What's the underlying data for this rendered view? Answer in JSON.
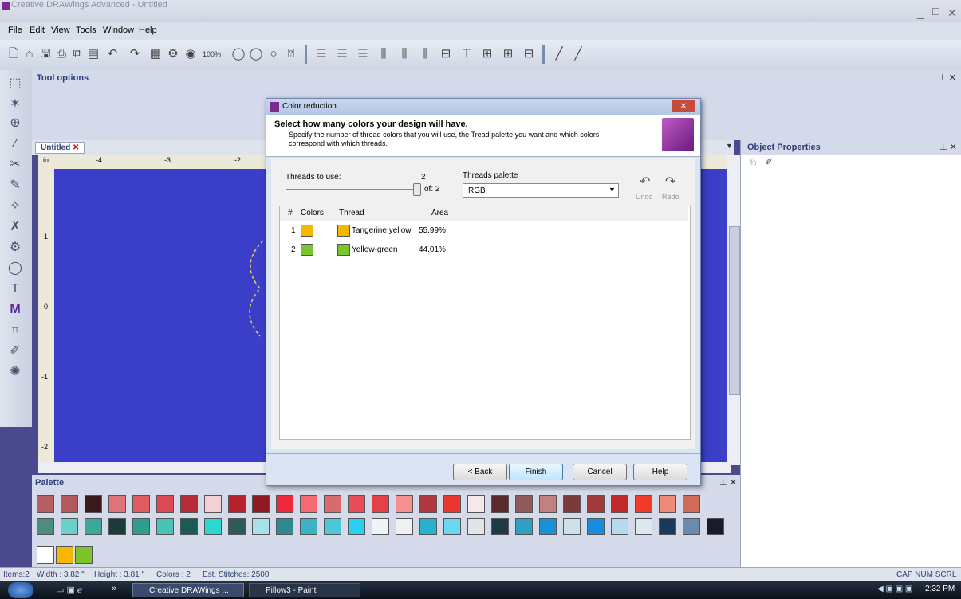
{
  "window": {
    "title": "Creative DRAWings Advanced - Untitled",
    "controls": [
      "_",
      "☐",
      "✕"
    ]
  },
  "menu": [
    "File",
    "Edit",
    "View",
    "Tools",
    "Window",
    "Help"
  ],
  "toolbar": {
    "zoom": "100%"
  },
  "panels": {
    "tool_options": "Tool options",
    "object_properties": "Object Properties",
    "palette": "Palette"
  },
  "document": {
    "tab": "Untitled",
    "ruler_unit": "in",
    "ruler_top": [
      "-4",
      "-3",
      "-2"
    ],
    "ruler_left": [
      "-1",
      "-0",
      "-1",
      "-2"
    ]
  },
  "dialog": {
    "title": "Color reduction",
    "heading": "Select how many colors your design will have.",
    "description": "Specify the number of thread colors that you will use, the Tread palette you want and which colors correspond with which threads.",
    "threads_to_use_label": "Threads to use:",
    "threads_value": "2",
    "of_label": "of: 2",
    "palette_label": "Threads palette",
    "palette_value": "RGB",
    "undo": "Undo",
    "redo": "Redo",
    "columns": [
      "#",
      "Colors",
      "Thread",
      "Area"
    ],
    "rows": [
      {
        "num": "1",
        "color": "#f5b800",
        "thread_color": "#f5b800",
        "thread": "Tangerine yellow",
        "area": "55.99%"
      },
      {
        "num": "2",
        "color": "#7cc42e",
        "thread_color": "#7cc42e",
        "thread": "Yellow-green",
        "area": "44.01%"
      }
    ],
    "buttons": {
      "back": "< Back",
      "finish": "Finish",
      "cancel": "Cancel",
      "help": "Help"
    }
  },
  "palette_row1": [
    "#b55f63",
    "#b05a5f",
    "#3a1a1c",
    "#e07479",
    "#e05c62",
    "#d94a55",
    "#b82b38",
    "#f3d0d5",
    "#b8202a",
    "#901a24",
    "#f0283c",
    "#f56a72",
    "#d96a70",
    "#ea4c58",
    "#e44048",
    "#f59090",
    "#b2363e",
    "#ea3530",
    "#f5e8ea",
    "#5a2a2c",
    "#8e5a5c",
    "#c28080",
    "#7a3a3c",
    "#a23a3c",
    "#c0282c",
    "#f23a2a",
    "#f08a78",
    "#d26a5a"
  ],
  "palette_row2": [
    "#4d8c7f",
    "#6ad0c8",
    "#3ca89a",
    "#1b3a3a",
    "#2e9e8e",
    "#4ac2b4",
    "#1c5a56",
    "#2ad8d0",
    "#2e5a58",
    "#a8e2e8",
    "#2e8a90",
    "#3ab4c4",
    "#4ac8d8",
    "#2ad0f0",
    "#f0f4f6",
    "#f0f0f0",
    "#2ab0d0",
    "#6ad8f0",
    "#e0e6e8",
    "#1e3a44",
    "#30a0c0",
    "#1a90d8",
    "#d0e0e8",
    "#1a8ce0",
    "#b8d8f0",
    "#dce8f0",
    "#1a3a5a",
    "#6a8ab0",
    "#1a1a2a"
  ],
  "palette_row3": [
    "#ffffff",
    "#f5b800",
    "#7cc42e"
  ],
  "status": {
    "items": "Items:2",
    "width": "Width : 3.82 \"",
    "height": "Height : 3.81 \"",
    "colors": "Colors : 2",
    "stitches": "Est. Stitches: 2500",
    "indicators": "CAP  NUM  SCRL"
  },
  "taskbar": {
    "task1": "Creative DRAWings ...",
    "task2": "Pillow3 - Paint",
    "clock": "2:32 PM",
    "chevron": "»"
  }
}
